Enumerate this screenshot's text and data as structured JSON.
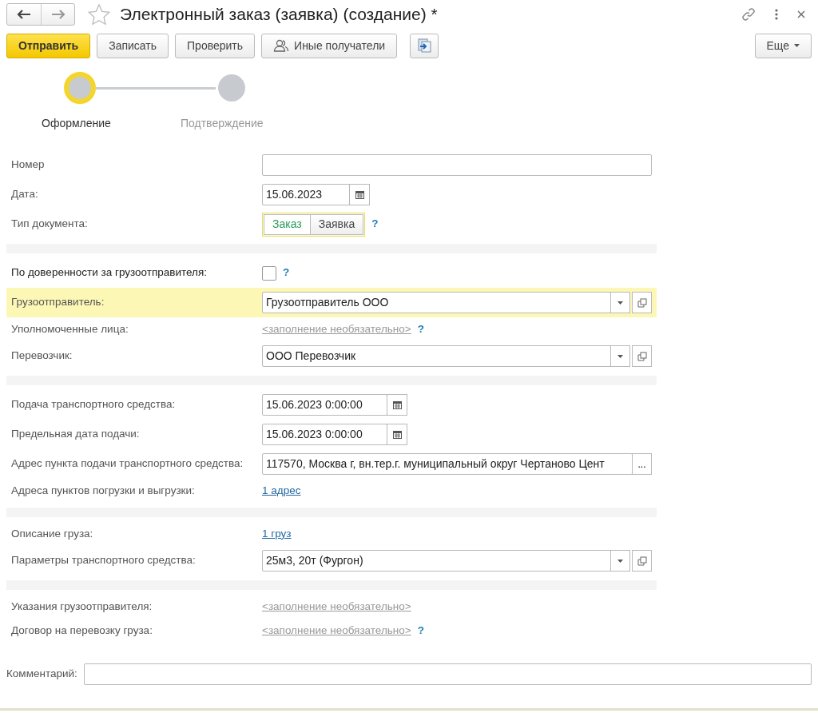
{
  "window": {
    "title": "Электронный заказ (заявка) (создание) *"
  },
  "toolbar": {
    "buttons": [
      {
        "label": "Отправить",
        "kind": "primary"
      },
      {
        "label": "Записать",
        "kind": "plain"
      },
      {
        "label": "Проверить",
        "kind": "plain"
      },
      {
        "label": "Иные получатели",
        "kind": "people"
      },
      {
        "kind": "export"
      }
    ],
    "more": "Еще"
  },
  "steps": [
    {
      "label": "Оформление",
      "selected": true
    },
    {
      "label": "Подтверждение",
      "selected": false
    }
  ],
  "sections": [
    [
      {
        "kind": "input",
        "label": "Номер"
      },
      {
        "kind": "date",
        "label": "Дата:",
        "value": "15.06.2023"
      },
      {
        "kind": "toggle",
        "label": "Тип документа:",
        "options": [
          {
            "label": "Заказ",
            "selected": true
          },
          {
            "label": "Заявка",
            "selected": false
          }
        ],
        "help": "?"
      }
    ],
    [
      {
        "kind": "checkbox",
        "label": "По доверенности за грузоотправителя:",
        "checked": false,
        "help": "?"
      },
      {
        "kind": "select",
        "label": "Грузоотправитель:",
        "value": "Грузоотправитель ООО",
        "highlighted": true
      },
      {
        "kind": "hint",
        "label": "Уполномоченные лица:",
        "value": "<заполнение необязательно>",
        "help": "?"
      },
      {
        "kind": "select",
        "label": "Перевозчик:",
        "value": "ООО Перевозчик",
        "highlighted": false
      }
    ],
    [
      {
        "kind": "date",
        "label": "Подача транспортного средства:",
        "value": "15.06.2023  0:00:00"
      },
      {
        "kind": "date",
        "label": "Предельная дата подачи:",
        "value": "15.06.2023  0:00:00"
      },
      {
        "kind": "address",
        "label": "Адрес пункта подачи транспортного средства:",
        "value": "117570, Москва г, вн.тер.г. муниципальный округ Чертаново Цент",
        "button": "..."
      },
      {
        "kind": "link",
        "label": "Адреса пунктов погрузки и выгрузки:",
        "value": "1 адрес"
      }
    ],
    [
      {
        "kind": "link",
        "label": "Описание груза:",
        "value": "1 груз"
      },
      {
        "kind": "select",
        "label": "Параметры транспортного средства:",
        "value": "25м3, 20т (Фургон)",
        "highlighted": false
      }
    ],
    [
      {
        "kind": "hint",
        "label": "Указания грузоотправителя:",
        "value": "<заполнение необязательно>"
      },
      {
        "kind": "hint",
        "label": "Договор на перевозку груза:",
        "value": "<заполнение необязательно>",
        "help": "?"
      }
    ]
  ],
  "comment": {
    "label": "Комментарий:"
  }
}
